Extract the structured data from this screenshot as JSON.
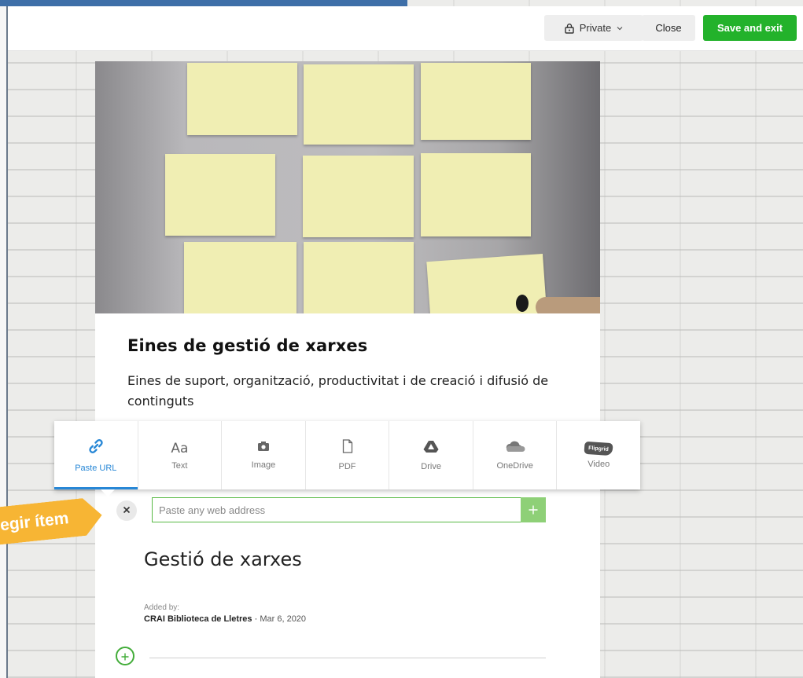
{
  "topbar": {
    "privacy_label": "Private",
    "close_label": "Close",
    "save_label": "Save and exit"
  },
  "card": {
    "title": "Eines de gestió de xarxes",
    "description": "Eines de suport, organització, productivitat i de creació i difusió de continguts"
  },
  "toolbar": {
    "items": [
      {
        "label": "Paste URL",
        "icon": "link-icon",
        "active": true
      },
      {
        "label": "Text",
        "icon": "text-icon"
      },
      {
        "label": "Image",
        "icon": "camera-icon"
      },
      {
        "label": "PDF",
        "icon": "pdf-icon"
      },
      {
        "label": "Drive",
        "icon": "drive-icon"
      },
      {
        "label": "OneDrive",
        "icon": "onedrive-icon"
      },
      {
        "label": "Video",
        "icon": "flipgrid-icon",
        "icon_text": "Flipgrid"
      }
    ]
  },
  "url": {
    "placeholder": "Paste any web address"
  },
  "section": {
    "title": "Gestió de xarxes",
    "added_label": "Added by:",
    "author": "CRAI Biblioteca de Lletres",
    "separator": "·",
    "date": "Mar 6, 2020"
  },
  "tag": {
    "text": "egir ítem"
  },
  "colors": {
    "accent_blue": "#2787d6",
    "save_green": "#23b22b",
    "input_green": "#58b944",
    "tag_orange": "#f7b534"
  }
}
